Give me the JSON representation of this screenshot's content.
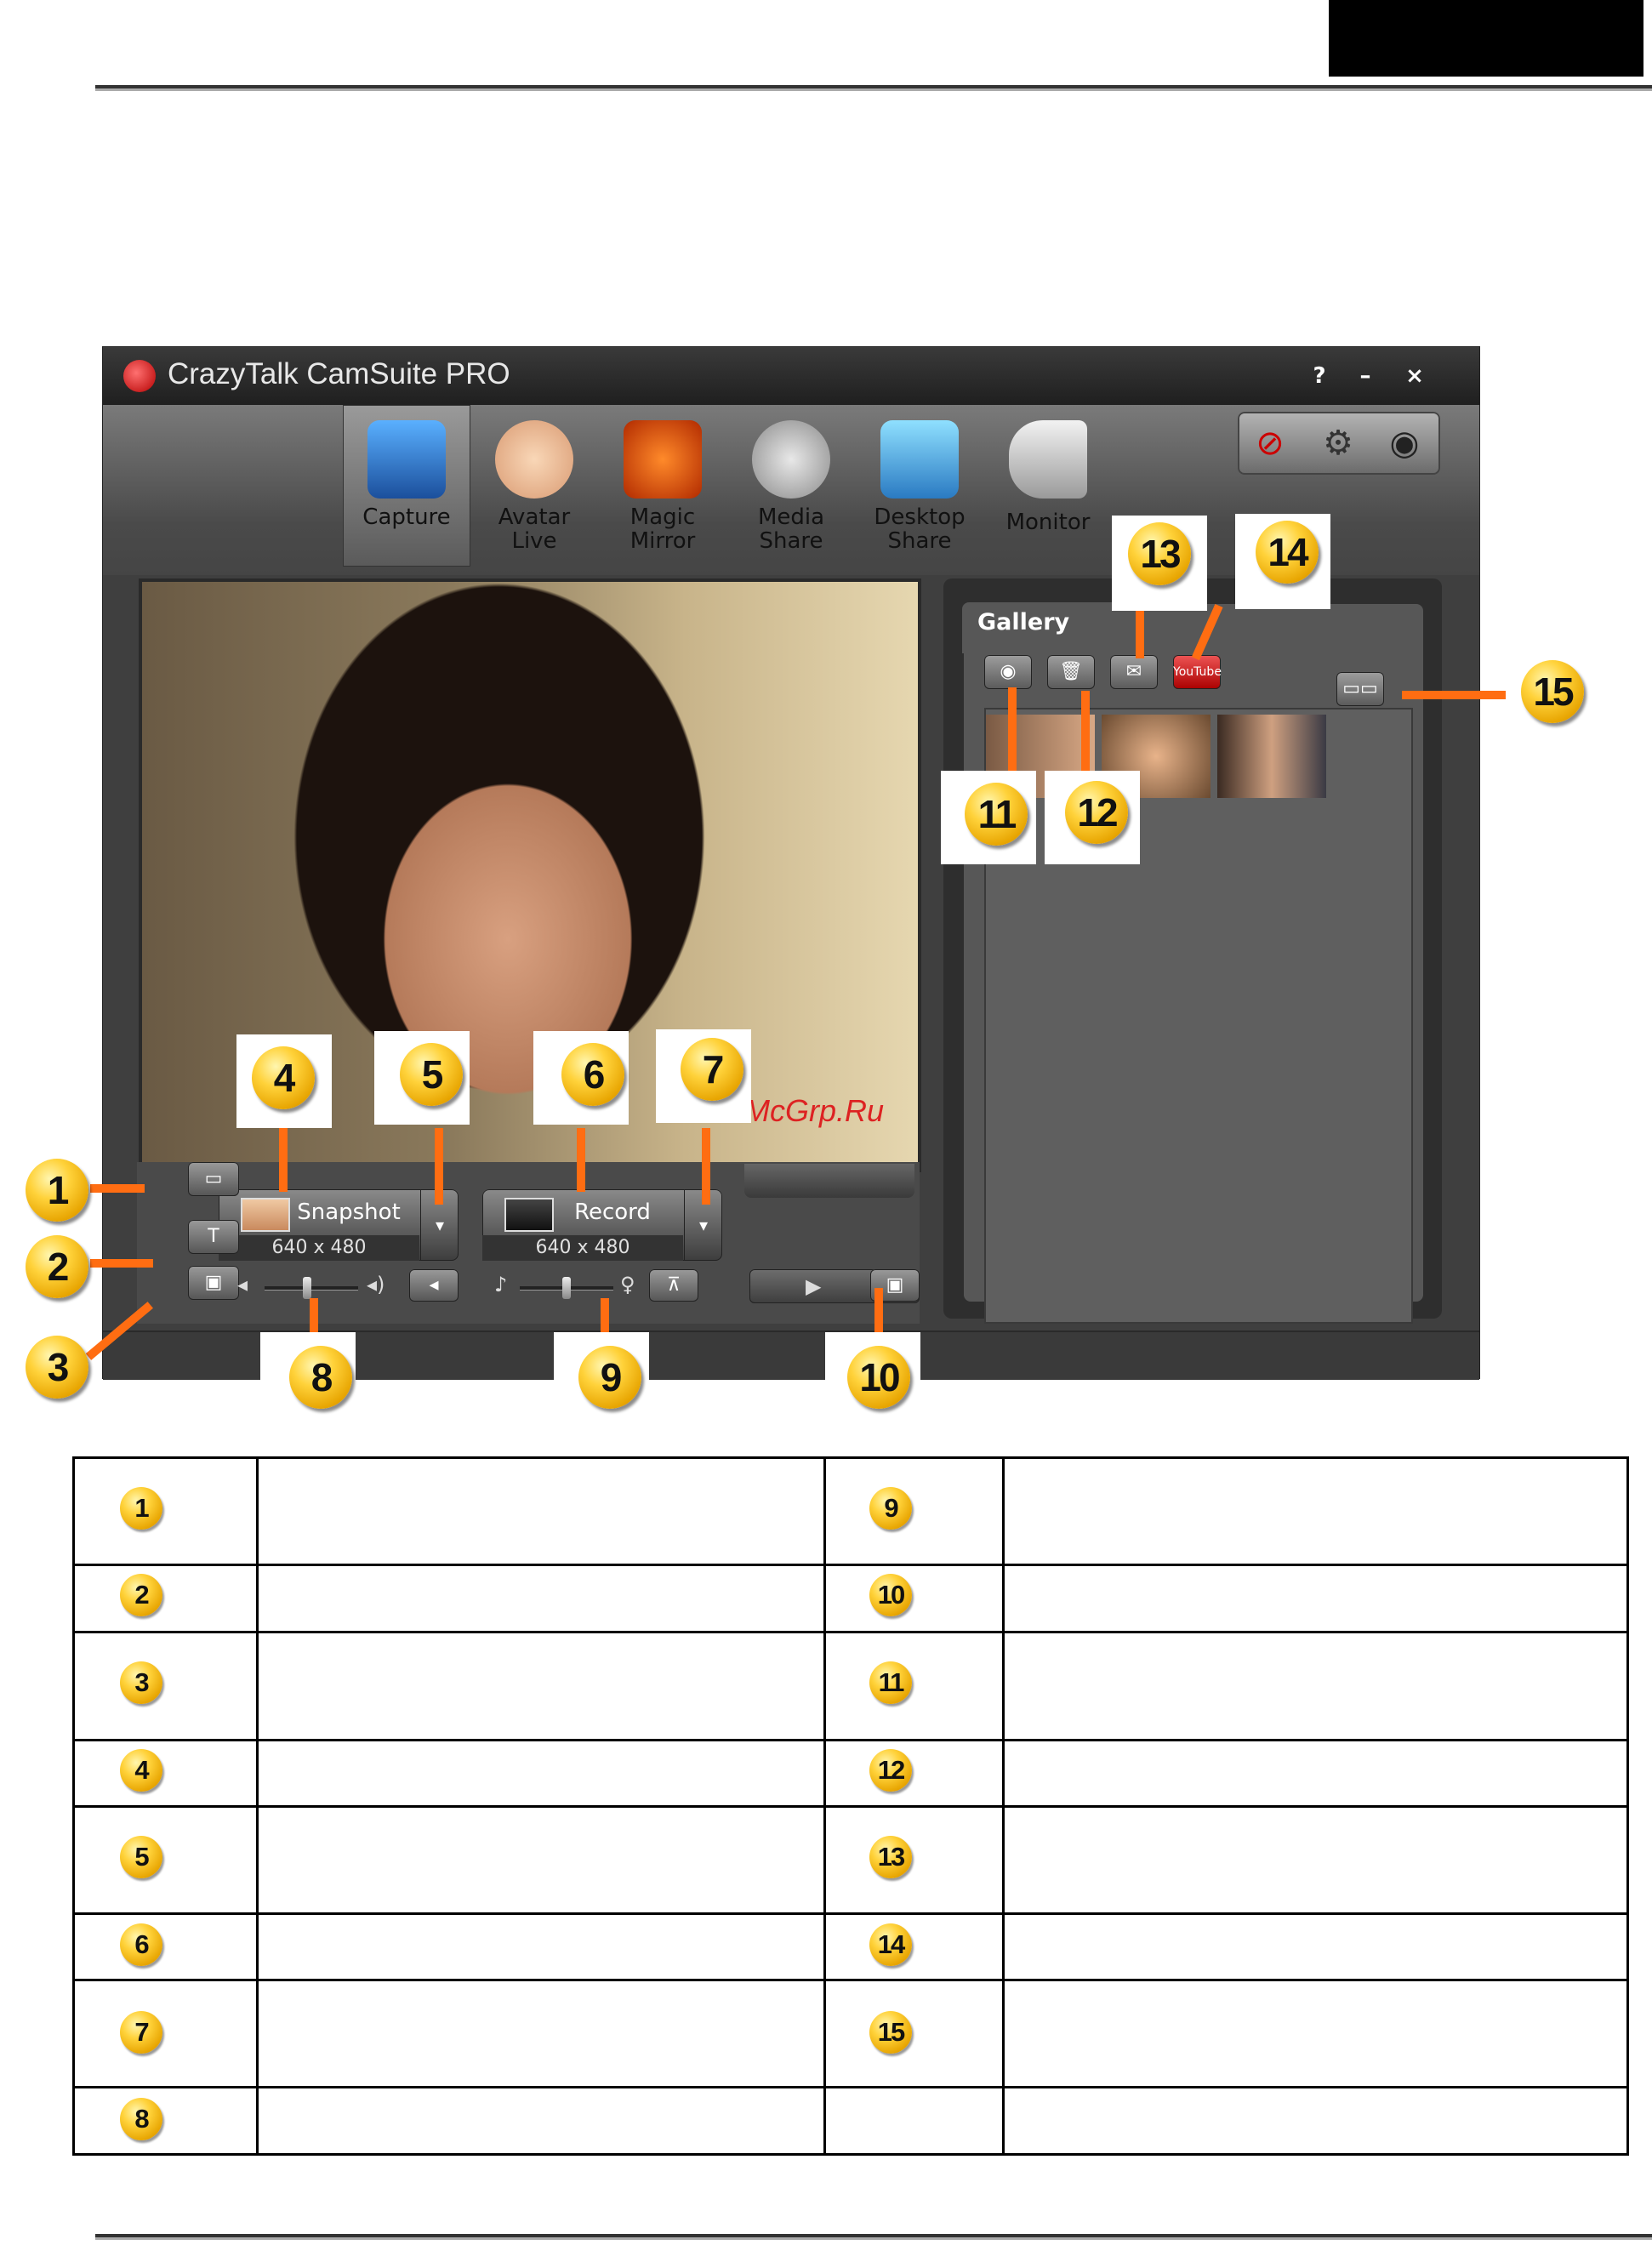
{
  "app": {
    "title": "CrazyTalk CamSuite PRO",
    "help_label": "?",
    "minimize_label": "–",
    "close_label": "×",
    "tabs": [
      {
        "label": "Capture",
        "icon": "camera-icon"
      },
      {
        "label": "Avatar\nLive",
        "icon": "baby-face-icon"
      },
      {
        "label": "Magic\nMirror",
        "icon": "mask-icon"
      },
      {
        "label": "Media\nShare",
        "icon": "film-reel-icon"
      },
      {
        "label": "Desktop\nShare",
        "icon": "desktop-icon"
      },
      {
        "label": "Monitor",
        "icon": "security-camera-icon"
      }
    ],
    "utility_icons": [
      "no-privacy-icon",
      "gear-icon",
      "webcam-settings-icon"
    ]
  },
  "capture": {
    "snapshot_label": "Snapshot",
    "snapshot_res": "640 x 480",
    "record_label": "Record",
    "record_res": "640 x 480",
    "dropdown_glyph": "▾",
    "volume_level": 0.45,
    "mic_level": 0.5
  },
  "gallery": {
    "title": "Gallery",
    "youtube_label": "YouTube"
  },
  "watermark": "McGrp.Ru",
  "callouts": [
    "1",
    "2",
    "3",
    "4",
    "5",
    "6",
    "7",
    "8",
    "9",
    "10",
    "11",
    "12",
    "13",
    "14",
    "15"
  ],
  "legend_rows": [
    {
      "left": "1",
      "right": "9"
    },
    {
      "left": "2",
      "right": "10"
    },
    {
      "left": "3",
      "right": "11"
    },
    {
      "left": "4",
      "right": "12"
    },
    {
      "left": "5",
      "right": "13"
    },
    {
      "left": "6",
      "right": "14"
    },
    {
      "left": "7",
      "right": "15"
    },
    {
      "left": "8",
      "right": ""
    }
  ],
  "colors": {
    "callout_line": "#ff6d12",
    "callout_badge": "#ffd23a",
    "window_bg": "#3f3f3f"
  }
}
